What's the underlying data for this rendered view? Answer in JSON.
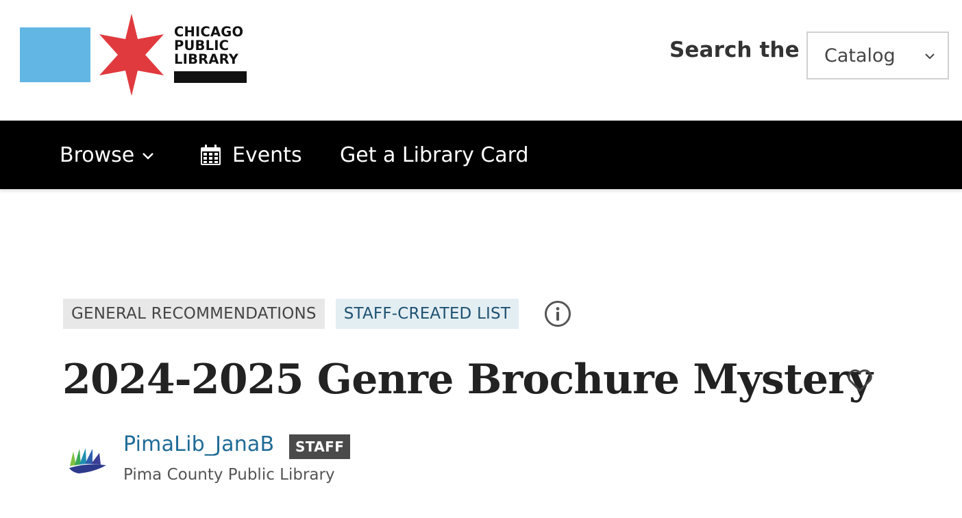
{
  "header": {
    "logo": {
      "line1": "CHICAGO",
      "line2": "PUBLIC",
      "line3": "LIBRARY",
      "square_color": "#62b6e4",
      "star_color": "#e03a3e"
    },
    "search_label": "Search the",
    "search_scope": {
      "selected": "Catalog",
      "icon": "chevron-down-icon"
    }
  },
  "nav": {
    "browse_label": "Browse",
    "events_label": "Events",
    "card_label": "Get a Library Card"
  },
  "list": {
    "badges": [
      "GENERAL RECOMMENDATIONS",
      "STAFF-CREATED LIST"
    ],
    "title": "2024-2025 Genre Brochure Mystery",
    "author": {
      "name": "PimaLib_JanaB",
      "role_tag": "STAFF",
      "organization": "Pima County Public Library"
    }
  },
  "colors": {
    "navbar": "#000000",
    "link": "#1f6b96",
    "staff_badge_bg": "#e3eef3",
    "general_badge_bg": "#e8e8e8"
  }
}
